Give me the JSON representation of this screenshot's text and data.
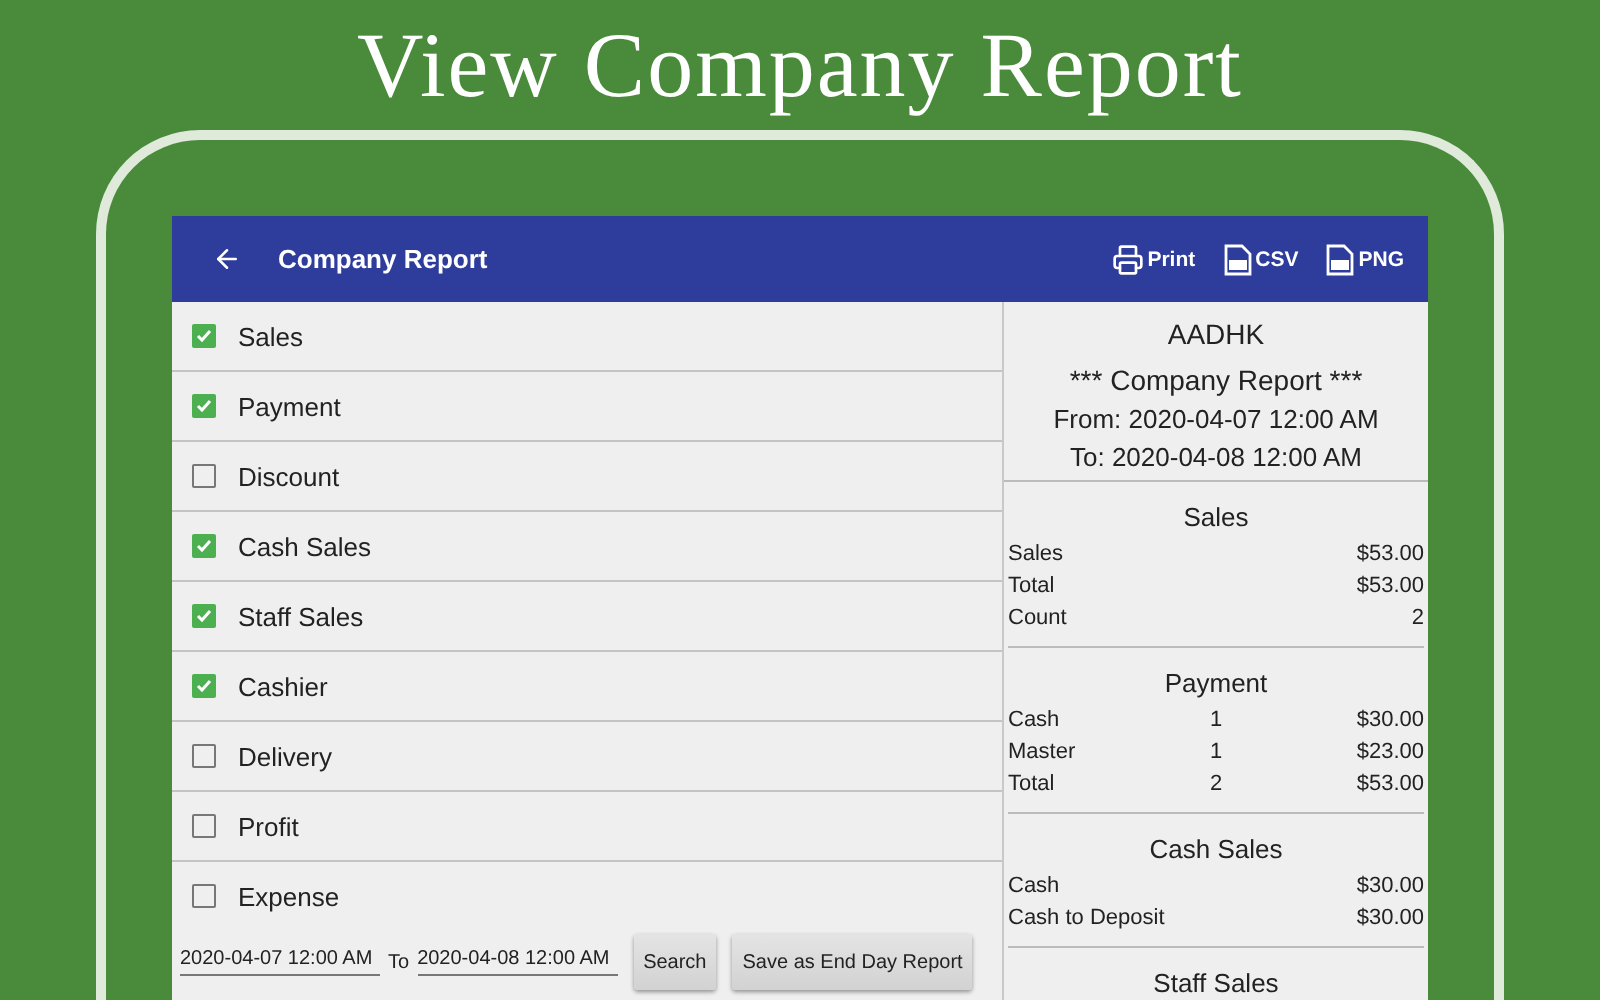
{
  "headline": "View Company Report",
  "app_bar": {
    "title": "Company Report",
    "actions": [
      {
        "kind": "print",
        "label": "Print"
      },
      {
        "kind": "csv",
        "label": "CSV"
      },
      {
        "kind": "png",
        "label": "PNG"
      }
    ]
  },
  "options": [
    {
      "label": "Sales",
      "checked": true
    },
    {
      "label": "Payment",
      "checked": true
    },
    {
      "label": "Discount",
      "checked": false
    },
    {
      "label": "Cash Sales",
      "checked": true
    },
    {
      "label": "Staff Sales",
      "checked": true
    },
    {
      "label": "Cashier",
      "checked": true
    },
    {
      "label": "Delivery",
      "checked": false
    },
    {
      "label": "Profit",
      "checked": false
    },
    {
      "label": "Expense",
      "checked": false
    }
  ],
  "filter": {
    "from": "2020-04-07 12:00 AM",
    "to_label": "To",
    "to": "2020-04-08 12:00 AM",
    "buttons": [
      "Search",
      "Save as End Day Report"
    ]
  },
  "report": {
    "company": "AADHK",
    "title": "*** Company Report ***",
    "from_label": "From:",
    "from": "2020-04-07 12:00 AM",
    "to_label": "To:",
    "to": "2020-04-08 12:00 AM",
    "sections": [
      {
        "title": "Sales",
        "rows": [
          {
            "label": "Sales",
            "amount": "$53.00"
          },
          {
            "label": "Total",
            "amount": "$53.00"
          },
          {
            "label": "Count",
            "amount": "2"
          }
        ]
      },
      {
        "title": "Payment",
        "rows": [
          {
            "label": "Cash",
            "count": "1",
            "amount": "$30.00"
          },
          {
            "label": "Master",
            "count": "1",
            "amount": "$23.00"
          },
          {
            "label": "Total",
            "count": "2",
            "amount": "$53.00"
          }
        ]
      },
      {
        "title": "Cash Sales",
        "rows": [
          {
            "label": "Cash",
            "amount": "$30.00"
          },
          {
            "label": "Cash to Deposit",
            "amount": "$30.00"
          }
        ]
      },
      {
        "title": "Staff Sales"
      }
    ]
  }
}
